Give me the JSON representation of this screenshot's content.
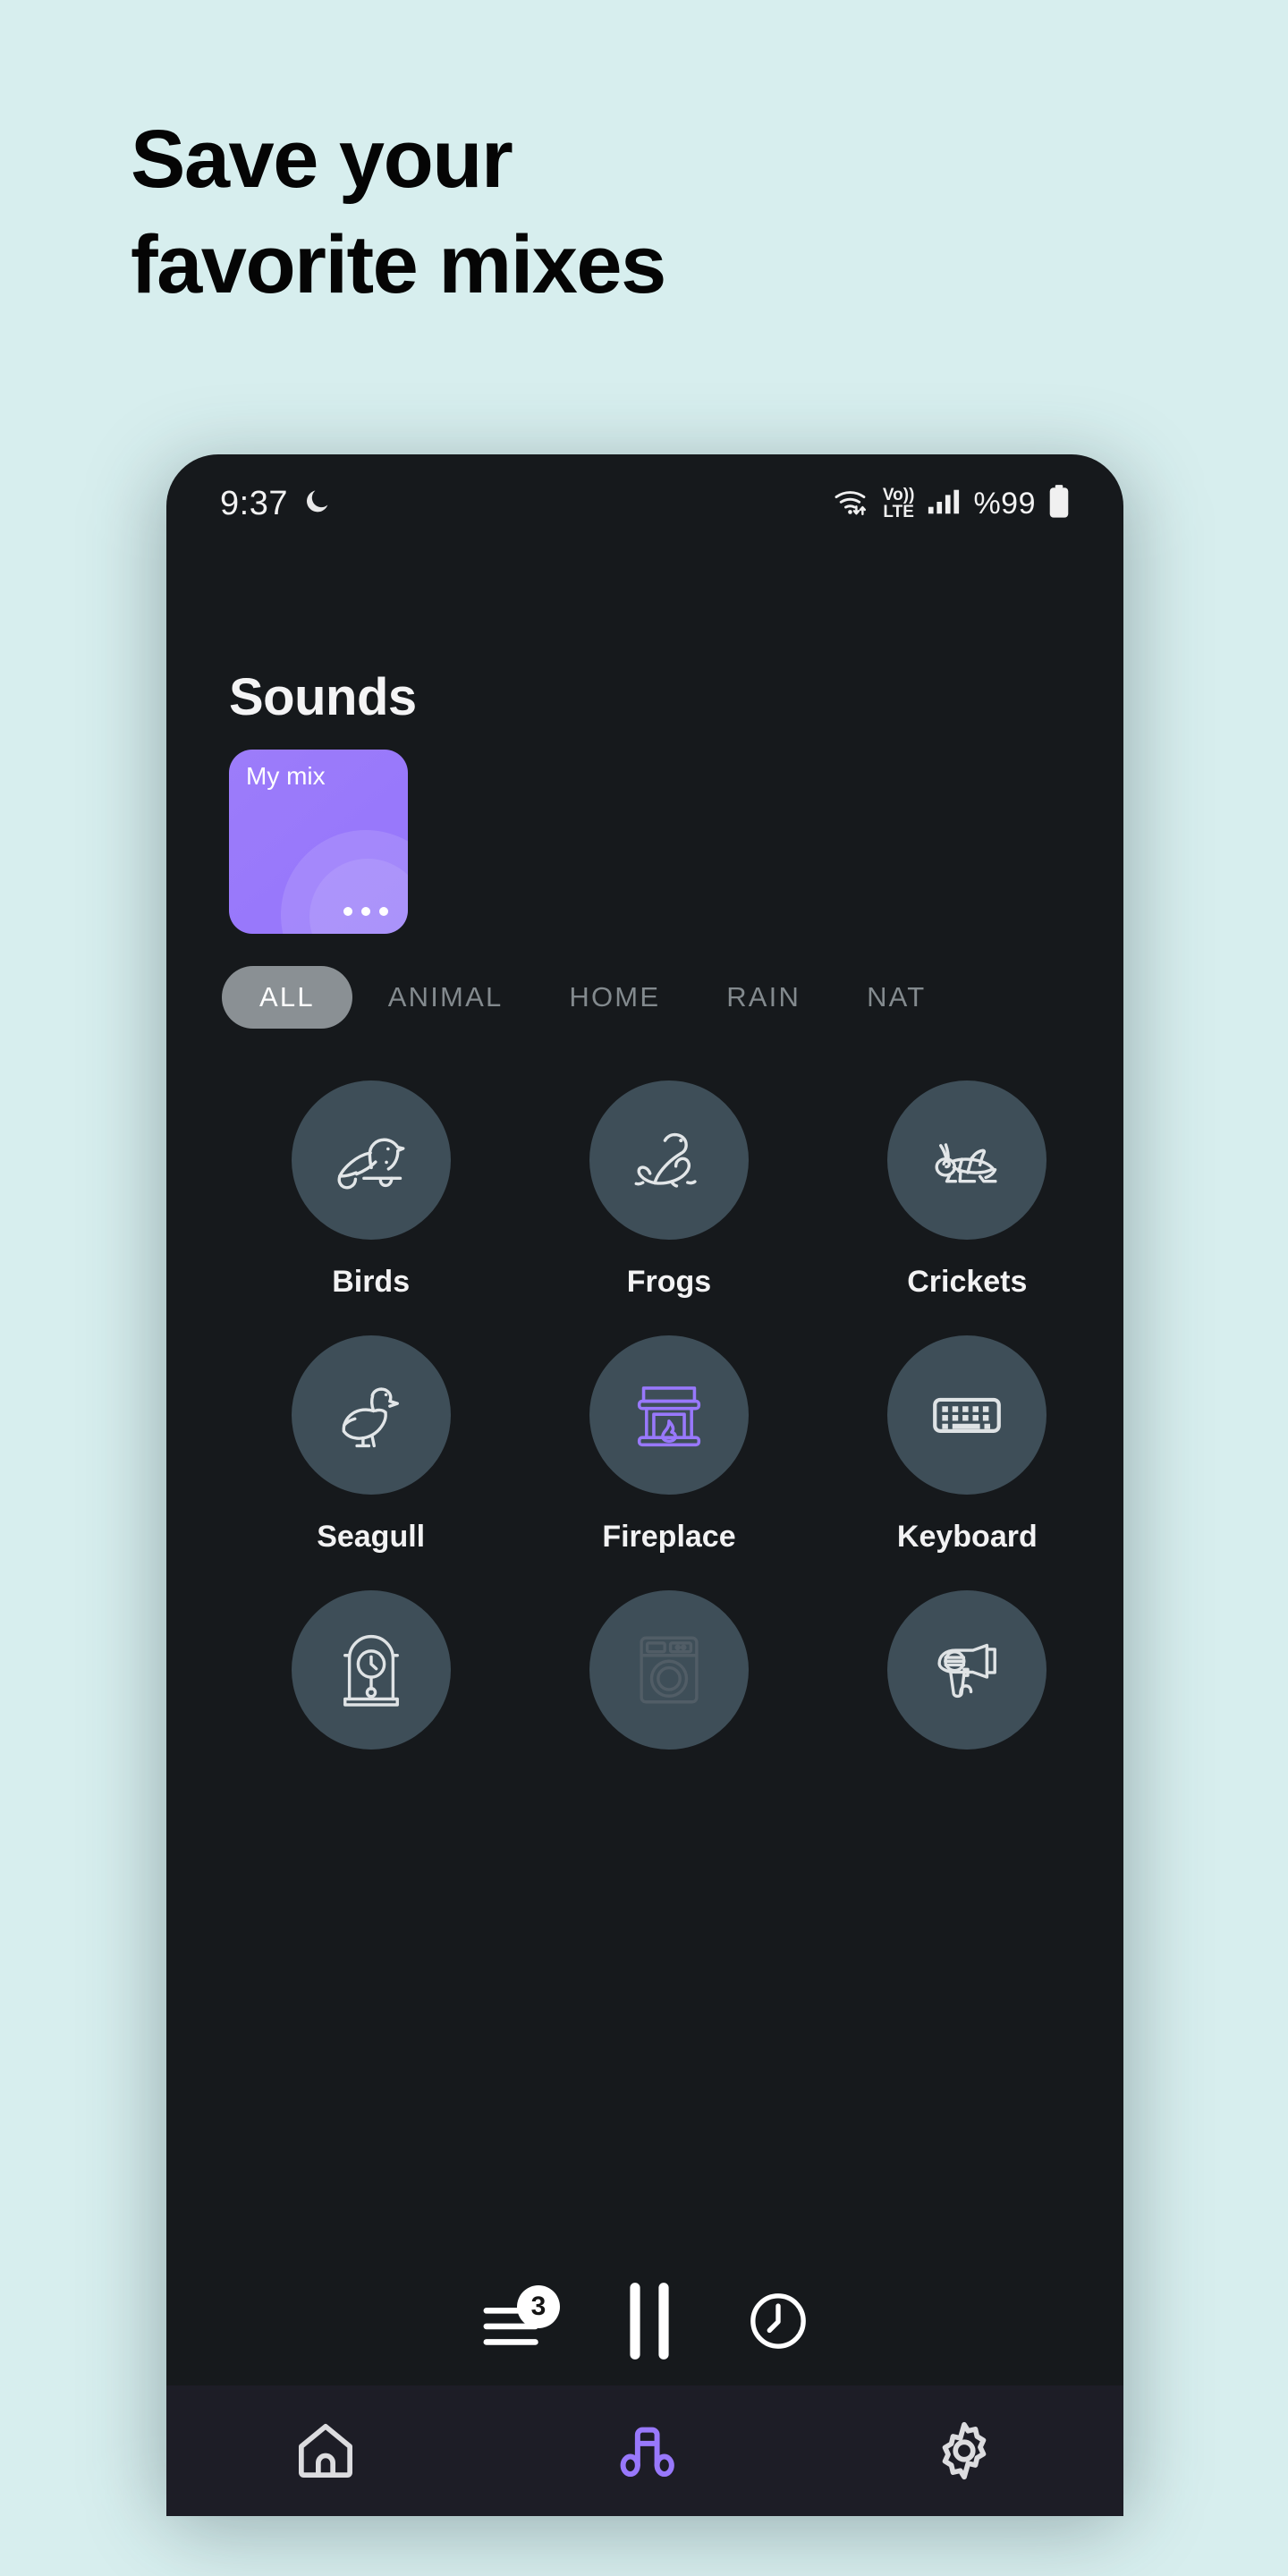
{
  "promo": {
    "line1": "Save your",
    "line2": "favorite mixes",
    "background_color": "#d7eeee",
    "text_color": "#050505"
  },
  "phone": {
    "background_color": "#16191c",
    "status_bar": {
      "time": "9:37",
      "dnd_icon": "moon-icon",
      "icons": [
        "wifi-icon",
        "volte-icon",
        "signal-icon"
      ],
      "volte_label_top": "Vo))",
      "volte_label_bottom": "LTE",
      "battery_percent": "%99",
      "battery_icon": "battery-icon"
    },
    "header": {
      "title": "Sounds"
    },
    "mix_card": {
      "label": "My mix",
      "color": "#9878fb",
      "menu_icon": "more-options-icon"
    },
    "tabs": [
      {
        "label": "ALL",
        "active": true
      },
      {
        "label": "ANIMAL",
        "active": false
      },
      {
        "label": "HOME",
        "active": false
      },
      {
        "label": "RAIN",
        "active": false
      },
      {
        "label": "NAT",
        "active": false
      }
    ],
    "sounds": [
      {
        "name": "Birds",
        "icon": "bird-icon",
        "active": false
      },
      {
        "name": "Frogs",
        "icon": "frog-icon",
        "active": false
      },
      {
        "name": "Crickets",
        "icon": "cricket-icon",
        "active": false
      },
      {
        "name": "Seagull",
        "icon": "seagull-icon",
        "active": false
      },
      {
        "name": "Fireplace",
        "icon": "fireplace-icon",
        "active": true
      },
      {
        "name": "Keyboard",
        "icon": "keyboard-icon",
        "active": false
      },
      {
        "name": "",
        "icon": "pendulum-clock-icon",
        "active": false
      },
      {
        "name": "",
        "icon": "washing-machine-icon",
        "active": false
      },
      {
        "name": "",
        "icon": "hair-dryer-icon",
        "active": false
      }
    ],
    "player": {
      "mixer_icon": "mixer-icon",
      "mixer_badge": "3",
      "pause_icon": "pause-icon",
      "timer_icon": "timer-icon"
    },
    "bottom_nav": [
      {
        "icon": "home-icon",
        "active": false
      },
      {
        "icon": "music-icon",
        "active": true
      },
      {
        "icon": "gear-icon",
        "active": false
      }
    ],
    "accent_color": "#9878fb",
    "disc_color": "#3e4e58"
  }
}
